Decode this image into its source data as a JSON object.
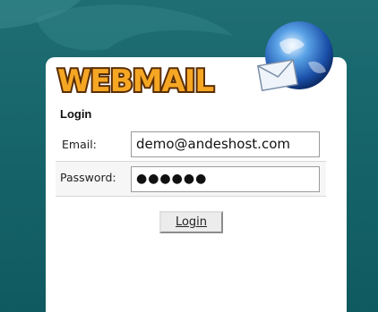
{
  "logo": {
    "text": "WEBMAIL"
  },
  "form": {
    "heading": "Login",
    "email_label": "Email:",
    "email_value": "demo@andeshost.com",
    "password_label": "Password:",
    "password_mask": "●●●●●●",
    "submit_label": "Login"
  },
  "colors": {
    "background_teal": "#1a6b71",
    "logo_orange": "#f5a623",
    "logo_outline": "#5a2e07",
    "card": "#ffffff"
  },
  "icons": [
    "globe-icon",
    "envelope-icon"
  ]
}
